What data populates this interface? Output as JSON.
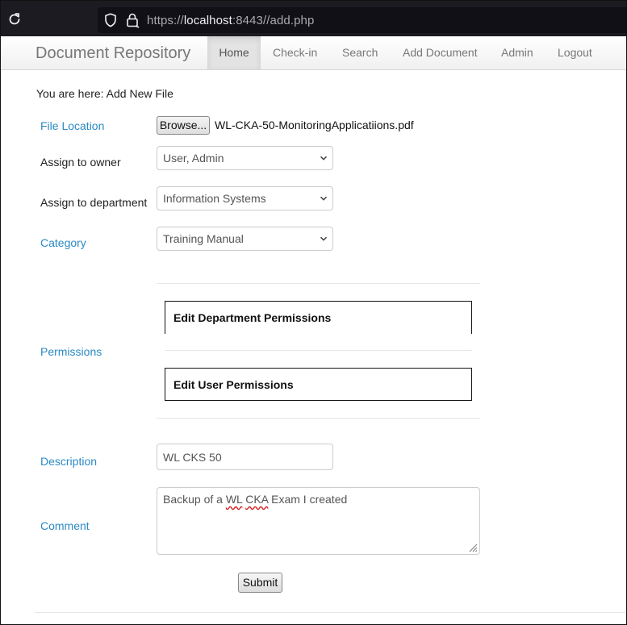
{
  "browser": {
    "url_prefix": "https://",
    "url_host": "localhost",
    "url_rest": ":8443//add.php"
  },
  "navbar": {
    "brand": "Document Repository",
    "items": [
      {
        "label": "Home",
        "active": true
      },
      {
        "label": "Check-in"
      },
      {
        "label": "Search"
      },
      {
        "label": "Add Document"
      },
      {
        "label": "Admin"
      },
      {
        "label": "Logout"
      }
    ]
  },
  "breadcrumb": "You are here: Add New File",
  "form": {
    "file_location_label": "File Location",
    "browse_label": "Browse...",
    "file_name": "WL-CKA-50-MonitoringApplicatiions.pdf",
    "owner_label": "Assign to owner",
    "owner_value": "User, Admin",
    "department_label": "Assign to department",
    "department_value": "Information Systems",
    "category_label": "Category",
    "category_value": "Training Manual",
    "permissions_label": "Permissions",
    "edit_department_permissions": "Edit Department Permissions",
    "edit_user_permissions": "Edit User Permissions",
    "description_label": "Description",
    "description_value": "WL CKS 50",
    "comment_label": "Comment",
    "comment_before": "Backup of a ",
    "comment_wl": "WL",
    "comment_space": " ",
    "comment_cka": "CKA",
    "comment_after": " Exam I created",
    "submit_label": "Submit"
  },
  "colors": {
    "browser_bg": "#1c1b22",
    "label_blue": "#2a8ac4",
    "spellcheck_red": "#d42020"
  }
}
